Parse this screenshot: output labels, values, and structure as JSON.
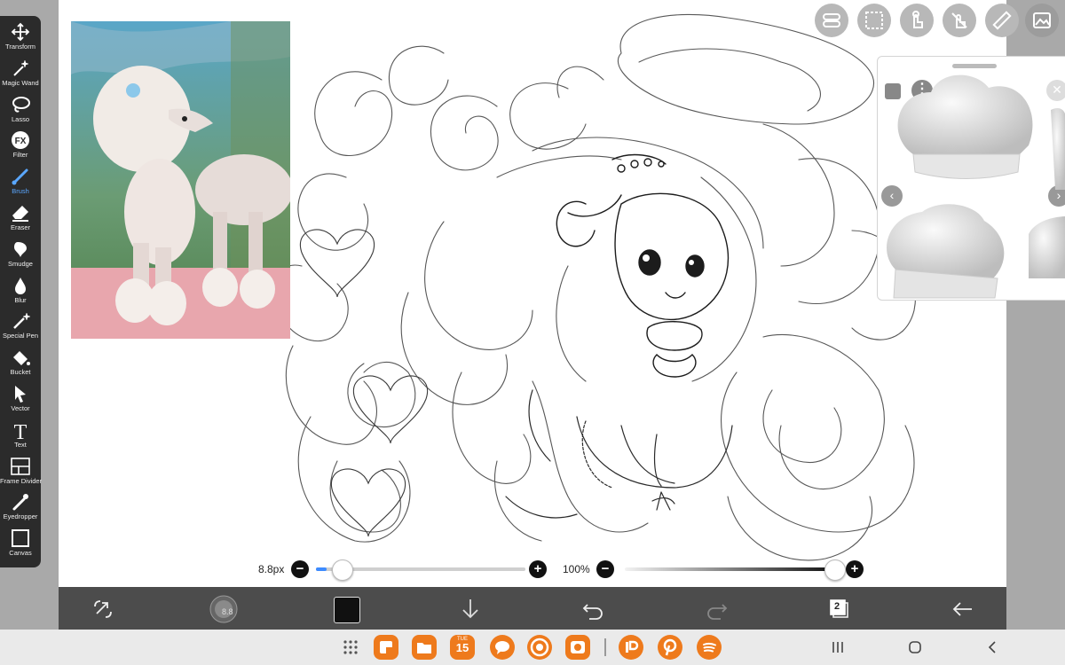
{
  "tools": [
    {
      "label": "Transform",
      "icon": "move-arrows-icon"
    },
    {
      "label": "Magic Wand",
      "icon": "magic-wand-icon"
    },
    {
      "label": "Lasso",
      "icon": "lasso-icon"
    },
    {
      "label": "Filter",
      "icon": "fx-icon"
    },
    {
      "label": "Brush",
      "icon": "brush-icon"
    },
    {
      "label": "Eraser",
      "icon": "eraser-icon"
    },
    {
      "label": "Smudge",
      "icon": "smudge-icon"
    },
    {
      "label": "Blur",
      "icon": "blur-drop-icon"
    },
    {
      "label": "Special Pen",
      "icon": "special-pen-icon"
    },
    {
      "label": "Bucket",
      "icon": "bucket-icon"
    },
    {
      "label": "Vector",
      "icon": "vector-cursor-icon"
    },
    {
      "label": "Text",
      "icon": "text-icon"
    },
    {
      "label": "Frame Divider",
      "icon": "frame-divider-icon"
    },
    {
      "label": "Eyedropper",
      "icon": "eyedropper-icon"
    },
    {
      "label": "Canvas",
      "icon": "canvas-icon"
    }
  ],
  "active_tool": "Brush",
  "filter_icon_text": "FX",
  "text_icon_text": "T",
  "brush_size": {
    "label": "8.8px",
    "fraction": 0.05
  },
  "opacity": {
    "label": "100%",
    "fraction": 1.0
  },
  "brush_thumb_label": "8.8",
  "layer_count": "2",
  "calendar": {
    "day": "TUE",
    "date": "15"
  },
  "colors": {
    "accent": "#3d8bff",
    "toolbar_bg": "#2b2b2b",
    "bottombar_bg": "#4c4c4c",
    "primary_color": "#111111",
    "app_orange": "#ee7a1c"
  },
  "top_buttons": [
    "toggle-icon",
    "selection-icon",
    "touch-hand-icon",
    "touch-off-icon",
    "ruler-icon",
    "reference-image-icon"
  ],
  "bottom_items": [
    "swap-transform-icon",
    "brush-preview-icon",
    "color-swatch-icon",
    "download-icon",
    "undo-icon",
    "redo-icon",
    "layers-icon",
    "back-arrow-icon"
  ],
  "apps": [
    "apps-grid-icon",
    "notes-app-icon",
    "files-app-icon",
    "calendar-app-icon",
    "messages-app-icon",
    "chrome-app-icon",
    "camera-app-icon",
    "ibispaint-app-icon",
    "pinterest-app-icon",
    "spotify-app-icon"
  ]
}
